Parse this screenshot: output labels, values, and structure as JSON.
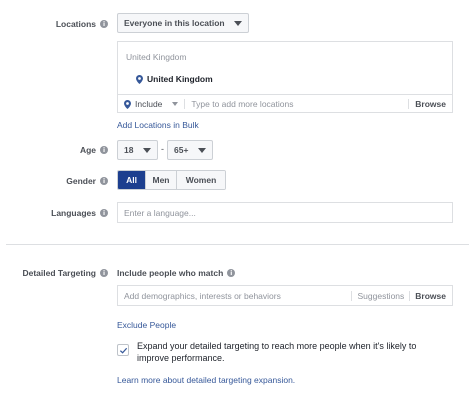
{
  "locations": {
    "label": "Locations",
    "audience_dropdown": "Everyone in this location",
    "header": "United Kingdom",
    "selected_location": "United Kingdom",
    "include_dropdown": "Include",
    "input_placeholder": "Type to add more locations",
    "browse_label": "Browse",
    "bulk_link": "Add Locations in Bulk"
  },
  "age": {
    "label": "Age",
    "min": "18",
    "separator": "-",
    "max": "65+"
  },
  "gender": {
    "label": "Gender",
    "options": [
      "All",
      "Men",
      "Women"
    ],
    "selected": "All"
  },
  "languages": {
    "label": "Languages",
    "placeholder": "Enter a language..."
  },
  "detailed_targeting": {
    "label": "Detailed Targeting",
    "include_heading": "Include people who match",
    "input_placeholder": "Add demographics, interests or behaviors",
    "suggestions_label": "Suggestions",
    "browse_label": "Browse",
    "exclude_link": "Exclude People",
    "expand_checked": true,
    "expand_text_line1": "Expand your detailed targeting to reach more people when it's likely to",
    "expand_text_line2": "improve performance.",
    "learn_more_link": "Learn more about detailed targeting expansion."
  },
  "colors": {
    "link": "#365899",
    "active_segment": "#1d3f8f",
    "pin": "#365899"
  },
  "icons": {
    "info": "info-icon",
    "pin": "location-pin-icon",
    "caret": "chevron-down-icon",
    "check": "check-icon"
  }
}
